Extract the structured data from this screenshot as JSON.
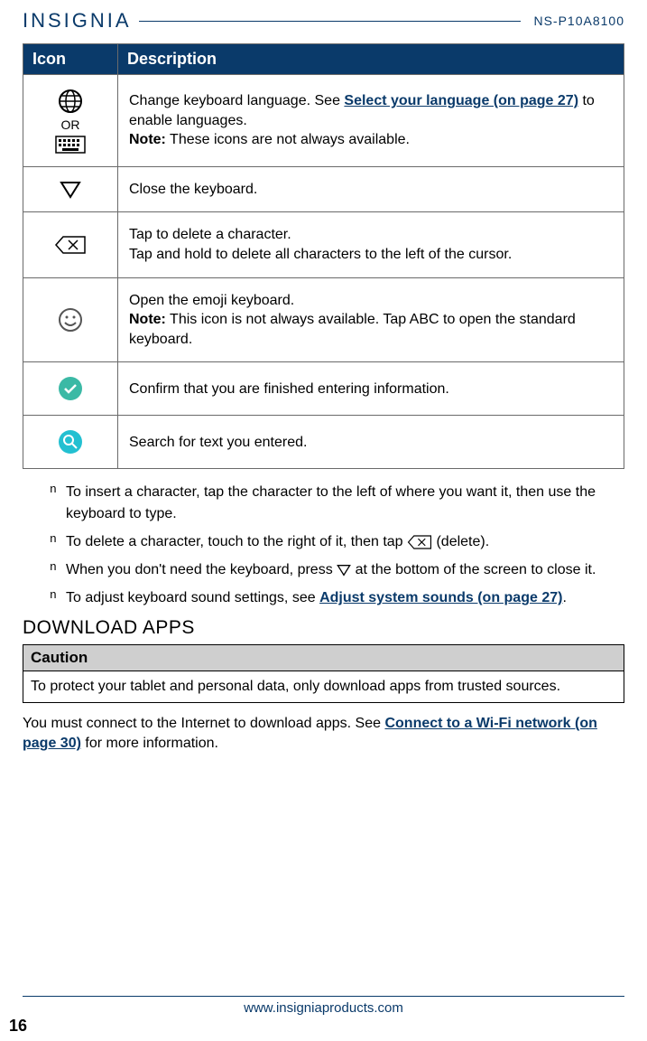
{
  "header": {
    "logo": "INSIGNIA",
    "model": "NS-P10A8100"
  },
  "table": {
    "head_icon": "Icon",
    "head_desc": "Description",
    "rows": [
      {
        "or": "OR",
        "desc_pre": "Change keyboard language. See ",
        "link": "Select your language (on page 27)",
        "desc_post": " to enable languages.",
        "note_label": "Note:",
        "note_text": " These icons are not always available."
      },
      {
        "desc": "Close the keyboard."
      },
      {
        "line1": "Tap to delete a character.",
        "line2": "Tap and hold to delete all characters to the left of the cursor."
      },
      {
        "line1": "Open the emoji keyboard.",
        "note_label": "Note:",
        "note_text": " This icon is not always available. Tap ABC to open the standard keyboard."
      },
      {
        "desc": "Confirm that you are finished entering information."
      },
      {
        "desc": "Search for text you entered."
      }
    ]
  },
  "tips": {
    "t1": "To insert a character, tap the character to the left of where you want it, then use the keyboard to type.",
    "t2_pre": "To delete a character, touch to the right of it, then tap ",
    "t2_post": " (delete).",
    "t3_pre": "When you don't need the keyboard, press ",
    "t3_post": " at the bottom of the screen to close it.",
    "t4_pre": "To adjust keyboard sound settings, see ",
    "t4_link": "Adjust system sounds (on page 27)",
    "t4_post": "."
  },
  "download": {
    "heading": "DOWNLOAD APPS",
    "caution_label": "Caution",
    "caution_text": "To protect your tablet and personal data, only download apps from trusted sources.",
    "body_pre": "You must connect to the Internet to download apps. See ",
    "body_link": "Connect to a Wi-Fi network (on page 30)",
    "body_post": " for more information."
  },
  "footer": {
    "url": "www.insigniaproducts.com",
    "page": "16"
  }
}
